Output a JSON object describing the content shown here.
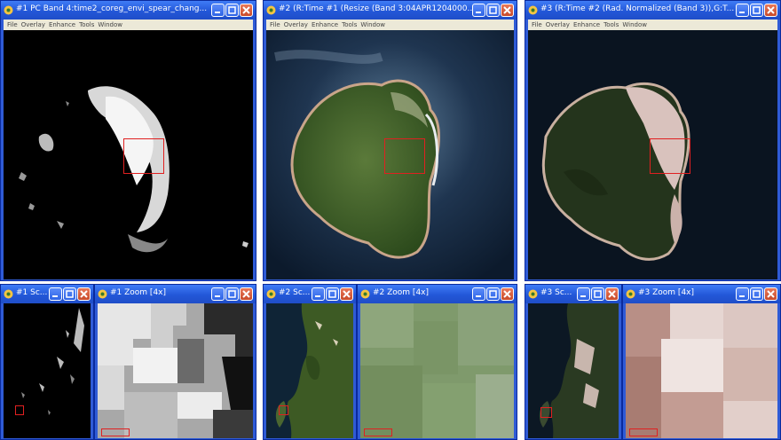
{
  "menu": [
    "File",
    "Overlay",
    "Enhance",
    "Tools",
    "Window"
  ],
  "windows": {
    "w1": {
      "title": "#1 PC Band 4:time2_coreg_envi_spear_chang..."
    },
    "w2": {
      "title": "#2 (R:Time #1 (Resize (Band 3:04APR1204000..."
    },
    "w3": {
      "title": "#3 (R:Time #2 (Rad. Normalized (Band 3)),G:T..."
    },
    "s1": {
      "title": "#1 Sc..."
    },
    "z1": {
      "title": "#1 Zoom [4x]"
    },
    "s2": {
      "title": "#2 Sc..."
    },
    "z2": {
      "title": "#2 Zoom [4x]"
    },
    "s3": {
      "title": "#3 Sc..."
    },
    "z3": {
      "title": "#3 Zoom [4x]"
    }
  },
  "colors": {
    "titlebar": "#2357d8",
    "frame": "#2f5bd6",
    "menubar": "#ece9d8",
    "roi": "#e02020"
  },
  "icons": [
    "app-icon",
    "minimize-icon",
    "maximize-icon",
    "close-icon"
  ]
}
